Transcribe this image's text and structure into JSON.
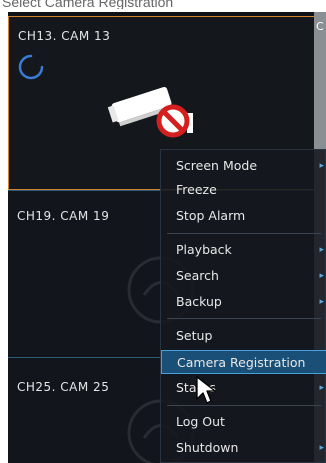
{
  "caption": "Select Camera Registration",
  "tiles": [
    {
      "label": "CH13. CAM 13"
    },
    {
      "label": "CH19. CAM 19"
    },
    {
      "label": "CH25. CAM 25"
    }
  ],
  "menu": {
    "items": [
      {
        "label": "Screen Mode",
        "submenu": true
      },
      {
        "label": "Freeze",
        "submenu": false
      },
      {
        "label": "Stop Alarm",
        "submenu": false
      },
      {
        "label": "Playback",
        "submenu": true
      },
      {
        "label": "Search",
        "submenu": true
      },
      {
        "label": "Backup",
        "submenu": true
      },
      {
        "label": "Setup",
        "submenu": false
      },
      {
        "label": "Camera Registration",
        "submenu": false,
        "selected": true
      },
      {
        "label": "Status",
        "submenu": true
      },
      {
        "label": "Log Out",
        "submenu": false
      },
      {
        "label": "Shutdown",
        "submenu": true
      }
    ],
    "arrow_glyph": "▸"
  },
  "colors": {
    "selected_bg": "#1a5077",
    "selected_border": "#4aa0dc",
    "active_tile_border": "#d0832a",
    "no_camera_red": "#d51f1f"
  },
  "icons": {
    "spinner": "loading-spinner-icon",
    "no_camera": "camera-disconnected-icon",
    "cursor": "mouse-pointer-icon"
  }
}
